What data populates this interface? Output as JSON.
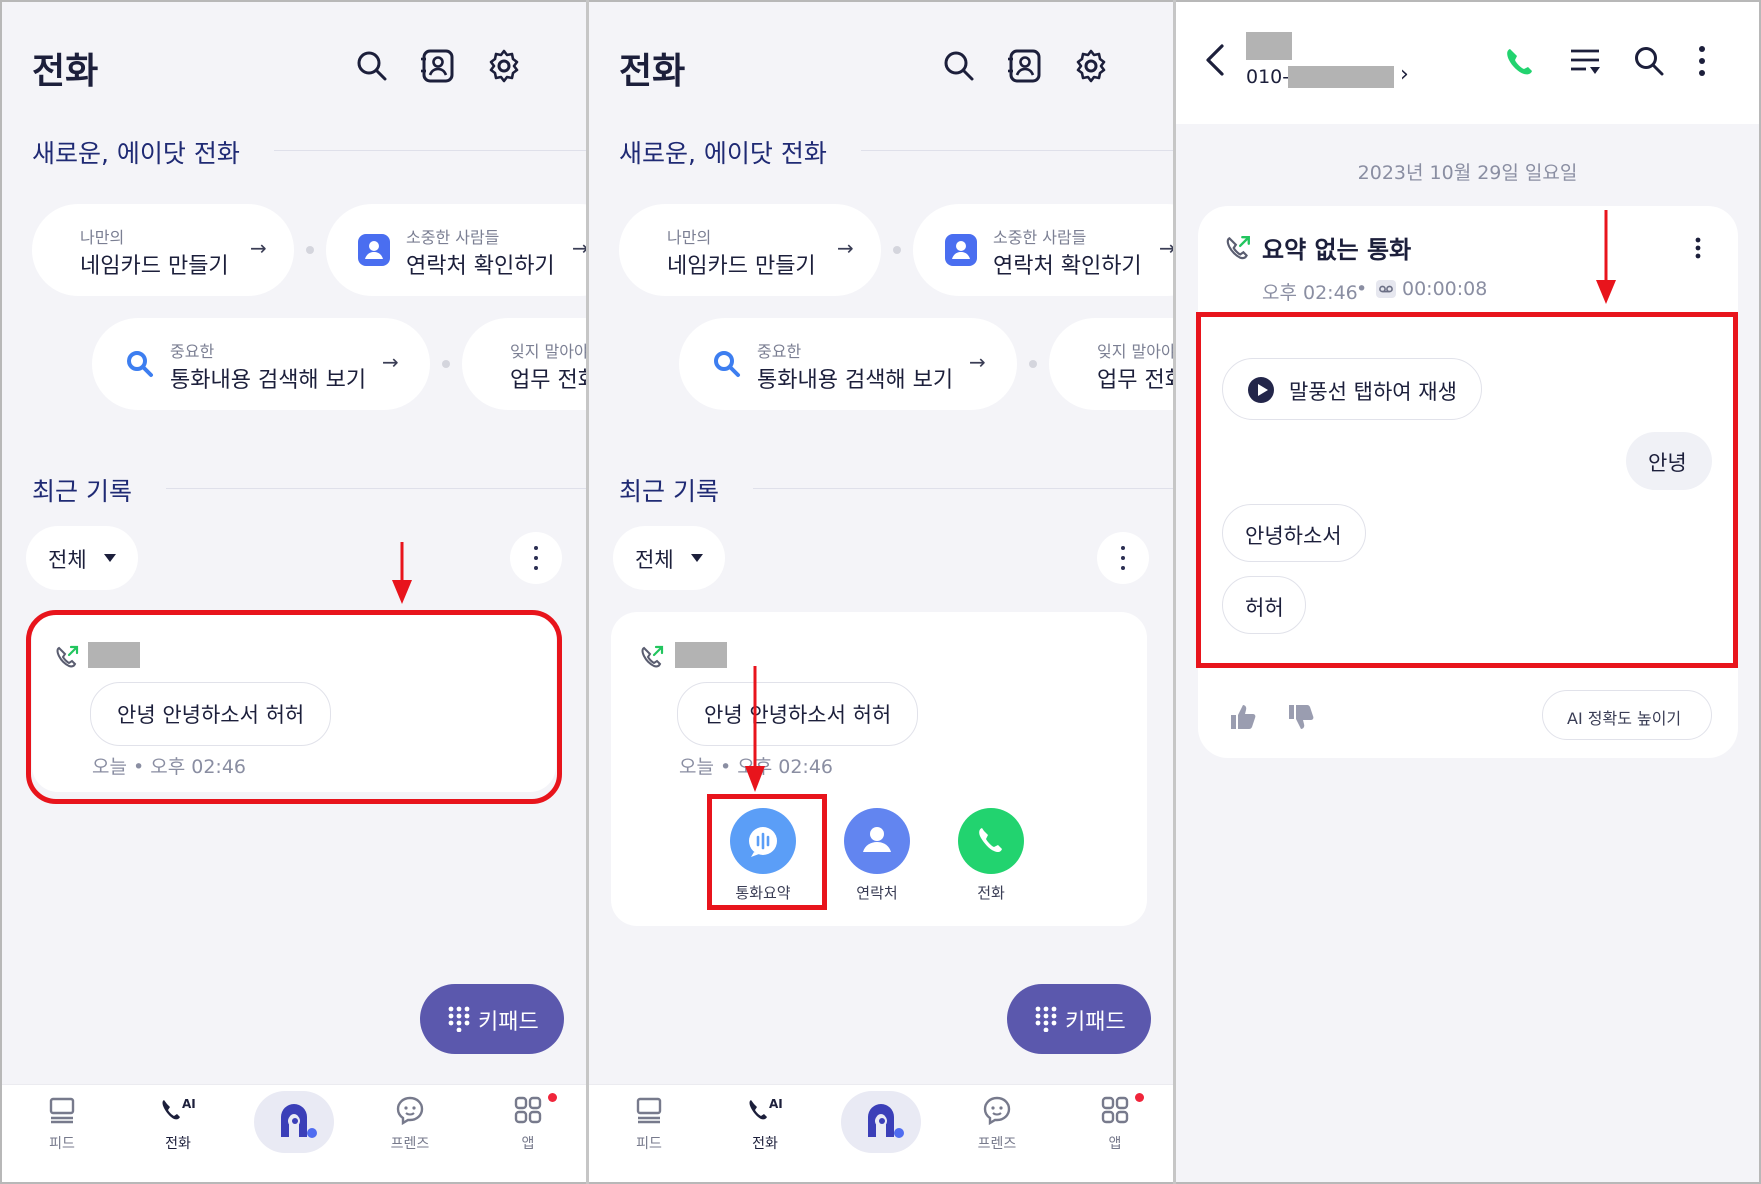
{
  "panel1": {
    "title": "전화",
    "section_new": "새로운, 에이닷 전화",
    "cards": [
      {
        "small": "나만의",
        "big": "네임카드 만들기"
      },
      {
        "small": "소중한 사람들",
        "big": "연락처 확인하기"
      },
      {
        "small": "중요한",
        "big": "통화내용 검색해 보기"
      },
      {
        "small": "잊지 말아야",
        "big": "업무 전화"
      }
    ],
    "section_recent": "최근 기록",
    "filter_label": "전체",
    "call_bubble": "안녕 안녕하소서 허허",
    "call_meta": "오늘 • 오후 02:46",
    "keypad_label": "키패드",
    "nav": [
      {
        "label": "피드"
      },
      {
        "label": "전화"
      },
      {
        "label": "프렌즈"
      },
      {
        "label": "앱"
      }
    ],
    "nav_ai": "AI"
  },
  "panel2": {
    "title": "전화",
    "section_new": "새로운, 에이닷 전화",
    "cards": [
      {
        "small": "나만의",
        "big": "네임카드 만들기"
      },
      {
        "small": "소중한 사람들",
        "big": "연락처 확인하기"
      },
      {
        "small": "중요한",
        "big": "통화내용 검색해 보기"
      },
      {
        "small": "잊지 말아야",
        "big": "업무 전화"
      }
    ],
    "section_recent": "최근 기록",
    "filter_label": "전체",
    "call_bubble": "안녕 안녕하소서 허허",
    "call_meta": "오늘 • 오후 02:46",
    "actions": [
      {
        "label": "통화요약",
        "color": "#5b9ef7"
      },
      {
        "label": "연락처",
        "color": "#6285f0"
      },
      {
        "label": "전화",
        "color": "#22d36f"
      }
    ],
    "keypad_label": "키패드",
    "nav": [
      {
        "label": "피드"
      },
      {
        "label": "전화"
      },
      {
        "label": "프렌즈"
      },
      {
        "label": "앱"
      }
    ],
    "nav_ai": "AI"
  },
  "panel3": {
    "phone_prefix": "010-",
    "chevron": "›",
    "date": "2023년 10월 29일 일요일",
    "card_title": "요약 없는 통화",
    "time": "오후 02:46",
    "duration": "00:00:08",
    "play_hint": "말풍선 탭하여 재생",
    "bubbles": [
      {
        "text": "안녕",
        "side": "right"
      },
      {
        "text": "안녕하소서",
        "side": "left"
      },
      {
        "text": "허허",
        "side": "left"
      }
    ],
    "accuracy_button": "AI 정확도 높이기"
  },
  "colors": {
    "accent": "#5b58ad",
    "highlight_red": "#e8141c",
    "call_green": "#22d36f",
    "navy_text": "#1f2a74"
  }
}
